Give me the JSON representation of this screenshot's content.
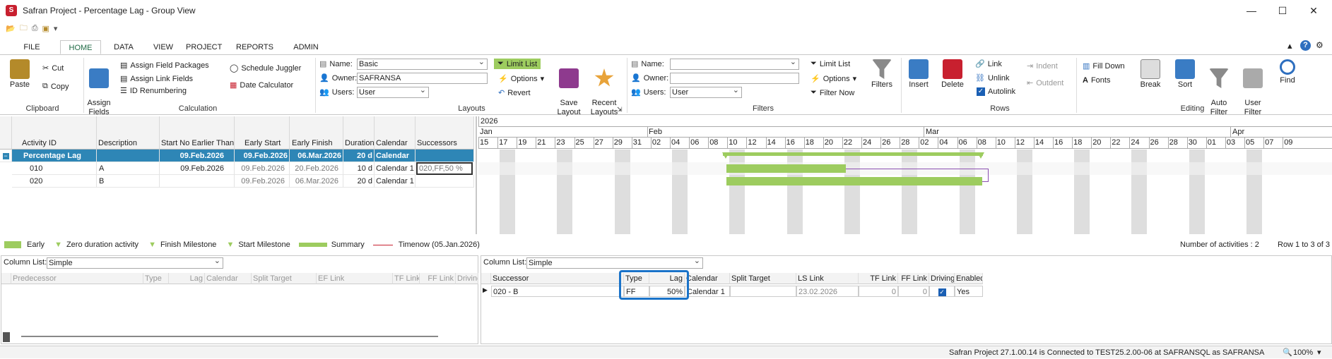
{
  "window": {
    "title": "Safran Project - Percentage Lag - Group View",
    "minimize": "—",
    "maximize": "☐",
    "close": "✕"
  },
  "menu": {
    "tabs": [
      "FILE",
      "HOME",
      "DATA",
      "VIEW",
      "PROJECT",
      "REPORTS",
      "ADMIN"
    ]
  },
  "ribbon": {
    "clipboard": {
      "paste": "Paste",
      "cut": "Cut",
      "copy": "Copy",
      "label": "Clipboard"
    },
    "calculation": {
      "assign_fields": "Assign\nFields",
      "assign_field_packages": "Assign Field Packages",
      "assign_link_fields": "Assign Link Fields",
      "id_renumbering": "ID Renumbering",
      "schedule_juggler": "Schedule Juggler",
      "date_calculator": "Date Calculator",
      "label": "Calculation"
    },
    "layouts": {
      "name_label": "Name:",
      "name_value": "Basic",
      "owner_label": "Owner:",
      "owner_value": "SAFRANSA",
      "users_label": "Users:",
      "users_value": "User",
      "limit_list": "Limit List",
      "options": "Options",
      "revert": "Revert",
      "save_layout": "Save\nLayout",
      "recent_layouts": "Recent\nLayouts",
      "label": "Layouts"
    },
    "filters": {
      "name_label": "Name:",
      "name_value": "",
      "owner_label": "Owner:",
      "owner_value": "",
      "users_label": "Users:",
      "users_value": "User",
      "limit_list": "Limit List",
      "options": "Options",
      "filter_now": "Filter Now",
      "filters": "Filters",
      "label": "Filters"
    },
    "rows": {
      "insert": "Insert",
      "delete": "Delete",
      "link": "Link",
      "unlink": "Unlink",
      "autolink": "Autolink",
      "indent": "Indent",
      "outdent": "Outdent",
      "label": "Rows"
    },
    "editing": {
      "fill_down": "Fill Down",
      "fonts": "Fonts",
      "break": "Break",
      "sort": "Sort",
      "auto_filter": "Auto\nFilter",
      "user_filter": "User\nFilter",
      "find": "Find",
      "label": "Editing"
    }
  },
  "grid": {
    "headers": [
      "Activity ID",
      "Description",
      "Start No Earlier Than",
      "Early Start",
      "Early Finish",
      "Duration",
      "Calendar",
      "Successors"
    ],
    "rows": [
      {
        "id": "Percentage Lag",
        "desc": "",
        "snet": "09.Feb.2026",
        "es": "09.Feb.2026",
        "ef": "06.Mar.2026",
        "dur": "20 d",
        "cal": "Calendar",
        "succ": ""
      },
      {
        "id": "010",
        "desc": "A",
        "snet": "09.Feb.2026",
        "es": "09.Feb.2026",
        "ef": "20.Feb.2026",
        "dur": "10 d",
        "cal": "Calendar 1",
        "succ": "020,FF,50 %"
      },
      {
        "id": "020",
        "desc": "B",
        "snet": "",
        "es": "09.Feb.2026",
        "ef": "06.Mar.2026",
        "dur": "20 d",
        "cal": "Calendar 1",
        "succ": ""
      }
    ]
  },
  "gantt": {
    "year": "2026",
    "months": [
      "Jan",
      "Feb",
      "Mar",
      "Apr"
    ],
    "days": [
      "15",
      "17",
      "19",
      "21",
      "23",
      "25",
      "27",
      "29",
      "31",
      "02",
      "04",
      "06",
      "08",
      "10",
      "12",
      "14",
      "16",
      "18",
      "20",
      "22",
      "24",
      "26",
      "28",
      "02",
      "04",
      "06",
      "08",
      "10",
      "12",
      "14",
      "16",
      "18",
      "20",
      "22",
      "24",
      "26",
      "28",
      "30",
      "01",
      "03",
      "05",
      "07",
      "09"
    ]
  },
  "legend": {
    "early": "Early",
    "zero": "Zero duration activity",
    "finish_ms": "Finish Milestone",
    "start_ms": "Start Milestone",
    "summary": "Summary",
    "timenow": "Timenow (05.Jan.2026)",
    "count": "Number of activities : 2",
    "rows": "Row 1 to 3 of 3"
  },
  "pred_pane": {
    "column_list_label": "Column List:",
    "column_list_value": "Simple",
    "headers": [
      "Predecessor",
      "Type",
      "Lag",
      "Calendar",
      "Split Target",
      "EF Link",
      "TF Link",
      "FF Link",
      "Driving"
    ]
  },
  "succ_pane": {
    "column_list_label": "Column List:",
    "column_list_value": "Simple",
    "headers": [
      "Successor",
      "Type",
      "Lag",
      "Calendar",
      "Split Target",
      "LS Link",
      "TF Link",
      "FF Link",
      "Driving",
      "Enabled"
    ],
    "row": {
      "successor": "020 - B",
      "type": "FF",
      "lag": "50%",
      "calendar": "Calendar 1",
      "split": "",
      "ls_link": "23.02.2026",
      "tf": "0",
      "ff": "0",
      "driving": "✓",
      "enabled": "Yes"
    }
  },
  "status": {
    "text": "Safran Project 27.1.00.14 is Connected to TEST25.2.00-06 at SAFRANSQL as SAFRANSA",
    "zoom": "100%"
  },
  "colors": {
    "accent": "#2e86b6",
    "bar": "#9dcc5f",
    "highlight": "#1a73c9"
  }
}
